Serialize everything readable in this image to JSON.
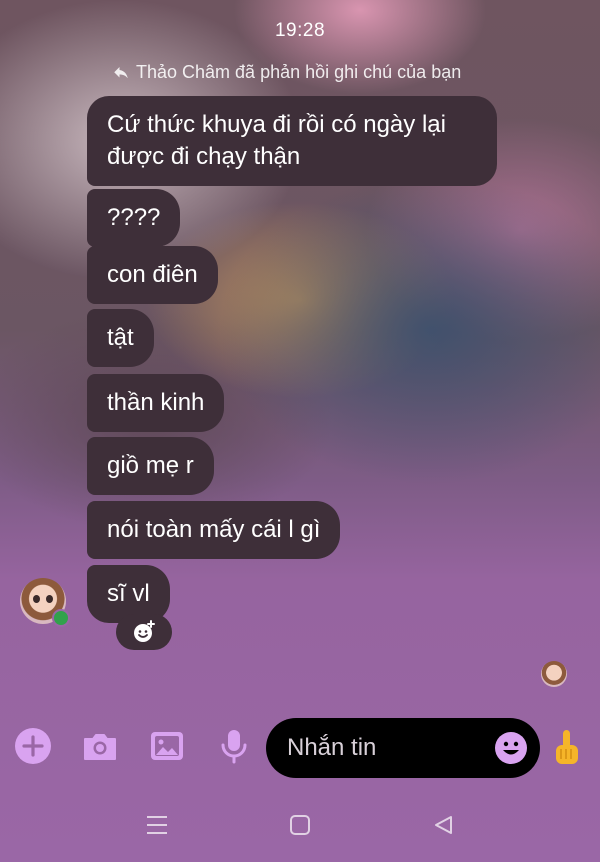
{
  "status_bar": {
    "time": "19:28"
  },
  "reply_note": {
    "text": "Thảo Châm đã phản hồi ghi chú của bạn"
  },
  "messages": [
    {
      "text": "Cứ thức khuya đi rồi có ngày lại được đi chạy thận"
    },
    {
      "text": "????"
    },
    {
      "text": "con điên"
    },
    {
      "text": "tật"
    },
    {
      "text": "thần kinh"
    },
    {
      "text": "giồ mẹ r"
    },
    {
      "text": "nói toàn mấy cái l gì"
    },
    {
      "text": "sĩ vl"
    }
  ],
  "composer": {
    "placeholder": "Nhắn tin",
    "icons": [
      "plus-icon",
      "camera-icon",
      "image-icon",
      "microphone-icon",
      "emoji-icon",
      "thumbs-up-icon"
    ],
    "accent": "#d9a3f0"
  },
  "nav_bar": {
    "icons": [
      "menu-icon",
      "home-icon",
      "back-icon"
    ]
  },
  "colors": {
    "bubble": "#3e2f39",
    "background_bottom": "#9a67a6",
    "online": "#31a24c"
  }
}
